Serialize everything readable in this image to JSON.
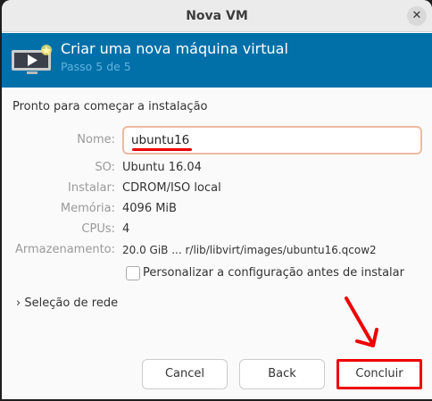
{
  "window": {
    "title": "Nova VM",
    "close_icon": "close-icon"
  },
  "header": {
    "title": "Criar uma nova máquina virtual",
    "subtitle": "Passo 5 de 5",
    "background": "#0270a8"
  },
  "section_title": "Pronto para começar a instalação",
  "fields": {
    "name": {
      "label": "Nome:",
      "value": "ubuntu16"
    },
    "os": {
      "label": "SO:",
      "value": "Ubuntu 16.04"
    },
    "install": {
      "label": "Instalar:",
      "value": "CDROM/ISO local"
    },
    "memory": {
      "label": "Memória:",
      "value": "4096 MiB"
    },
    "cpus": {
      "label": "CPUs:",
      "value": "4"
    },
    "storage": {
      "label": "Armazenamento:",
      "value": "20.0 GiB ... r/lib/libvirt/images/ubuntu16.qcow2"
    }
  },
  "customize": {
    "label": "Personalizar a configuração antes de instalar",
    "checked": false
  },
  "network": {
    "label": "Seleção de rede",
    "expanded": false
  },
  "buttons": {
    "cancel": "Cancel",
    "back": "Back",
    "finish": "Concluir"
  },
  "annotation_color": "#e00000"
}
